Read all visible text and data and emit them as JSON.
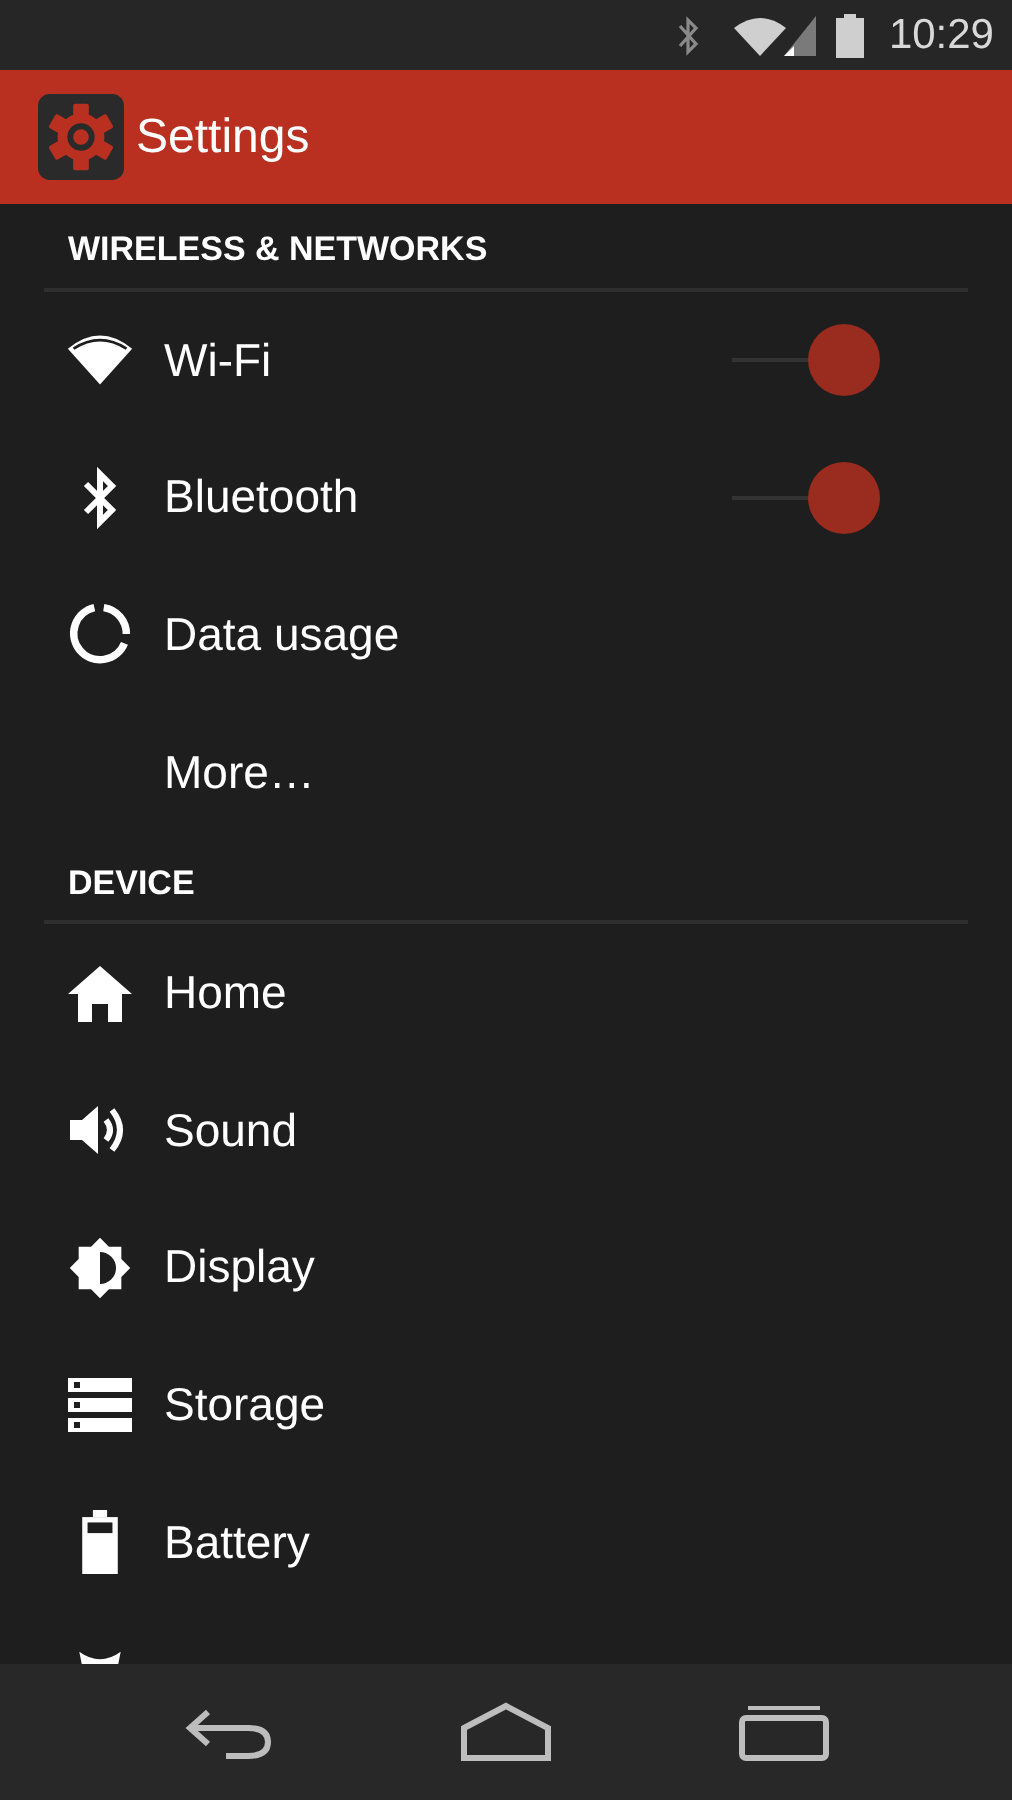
{
  "status_bar": {
    "time": "10:29"
  },
  "app_bar": {
    "title": "Settings"
  },
  "sections": [
    {
      "title": "WIRELESS & NETWORKS",
      "items": [
        {
          "kind": "toggle",
          "label": "Wi-Fi",
          "on": true
        },
        {
          "kind": "toggle",
          "label": "Bluetooth",
          "on": true
        },
        {
          "kind": "plain",
          "label": "Data usage"
        },
        {
          "kind": "plain",
          "label": "More…"
        }
      ]
    },
    {
      "title": "DEVICE",
      "items": [
        {
          "kind": "plain",
          "label": "Home"
        },
        {
          "kind": "plain",
          "label": "Sound"
        },
        {
          "kind": "plain",
          "label": "Display"
        },
        {
          "kind": "plain",
          "label": "Storage"
        },
        {
          "kind": "plain",
          "label": "Battery"
        }
      ]
    }
  ]
}
